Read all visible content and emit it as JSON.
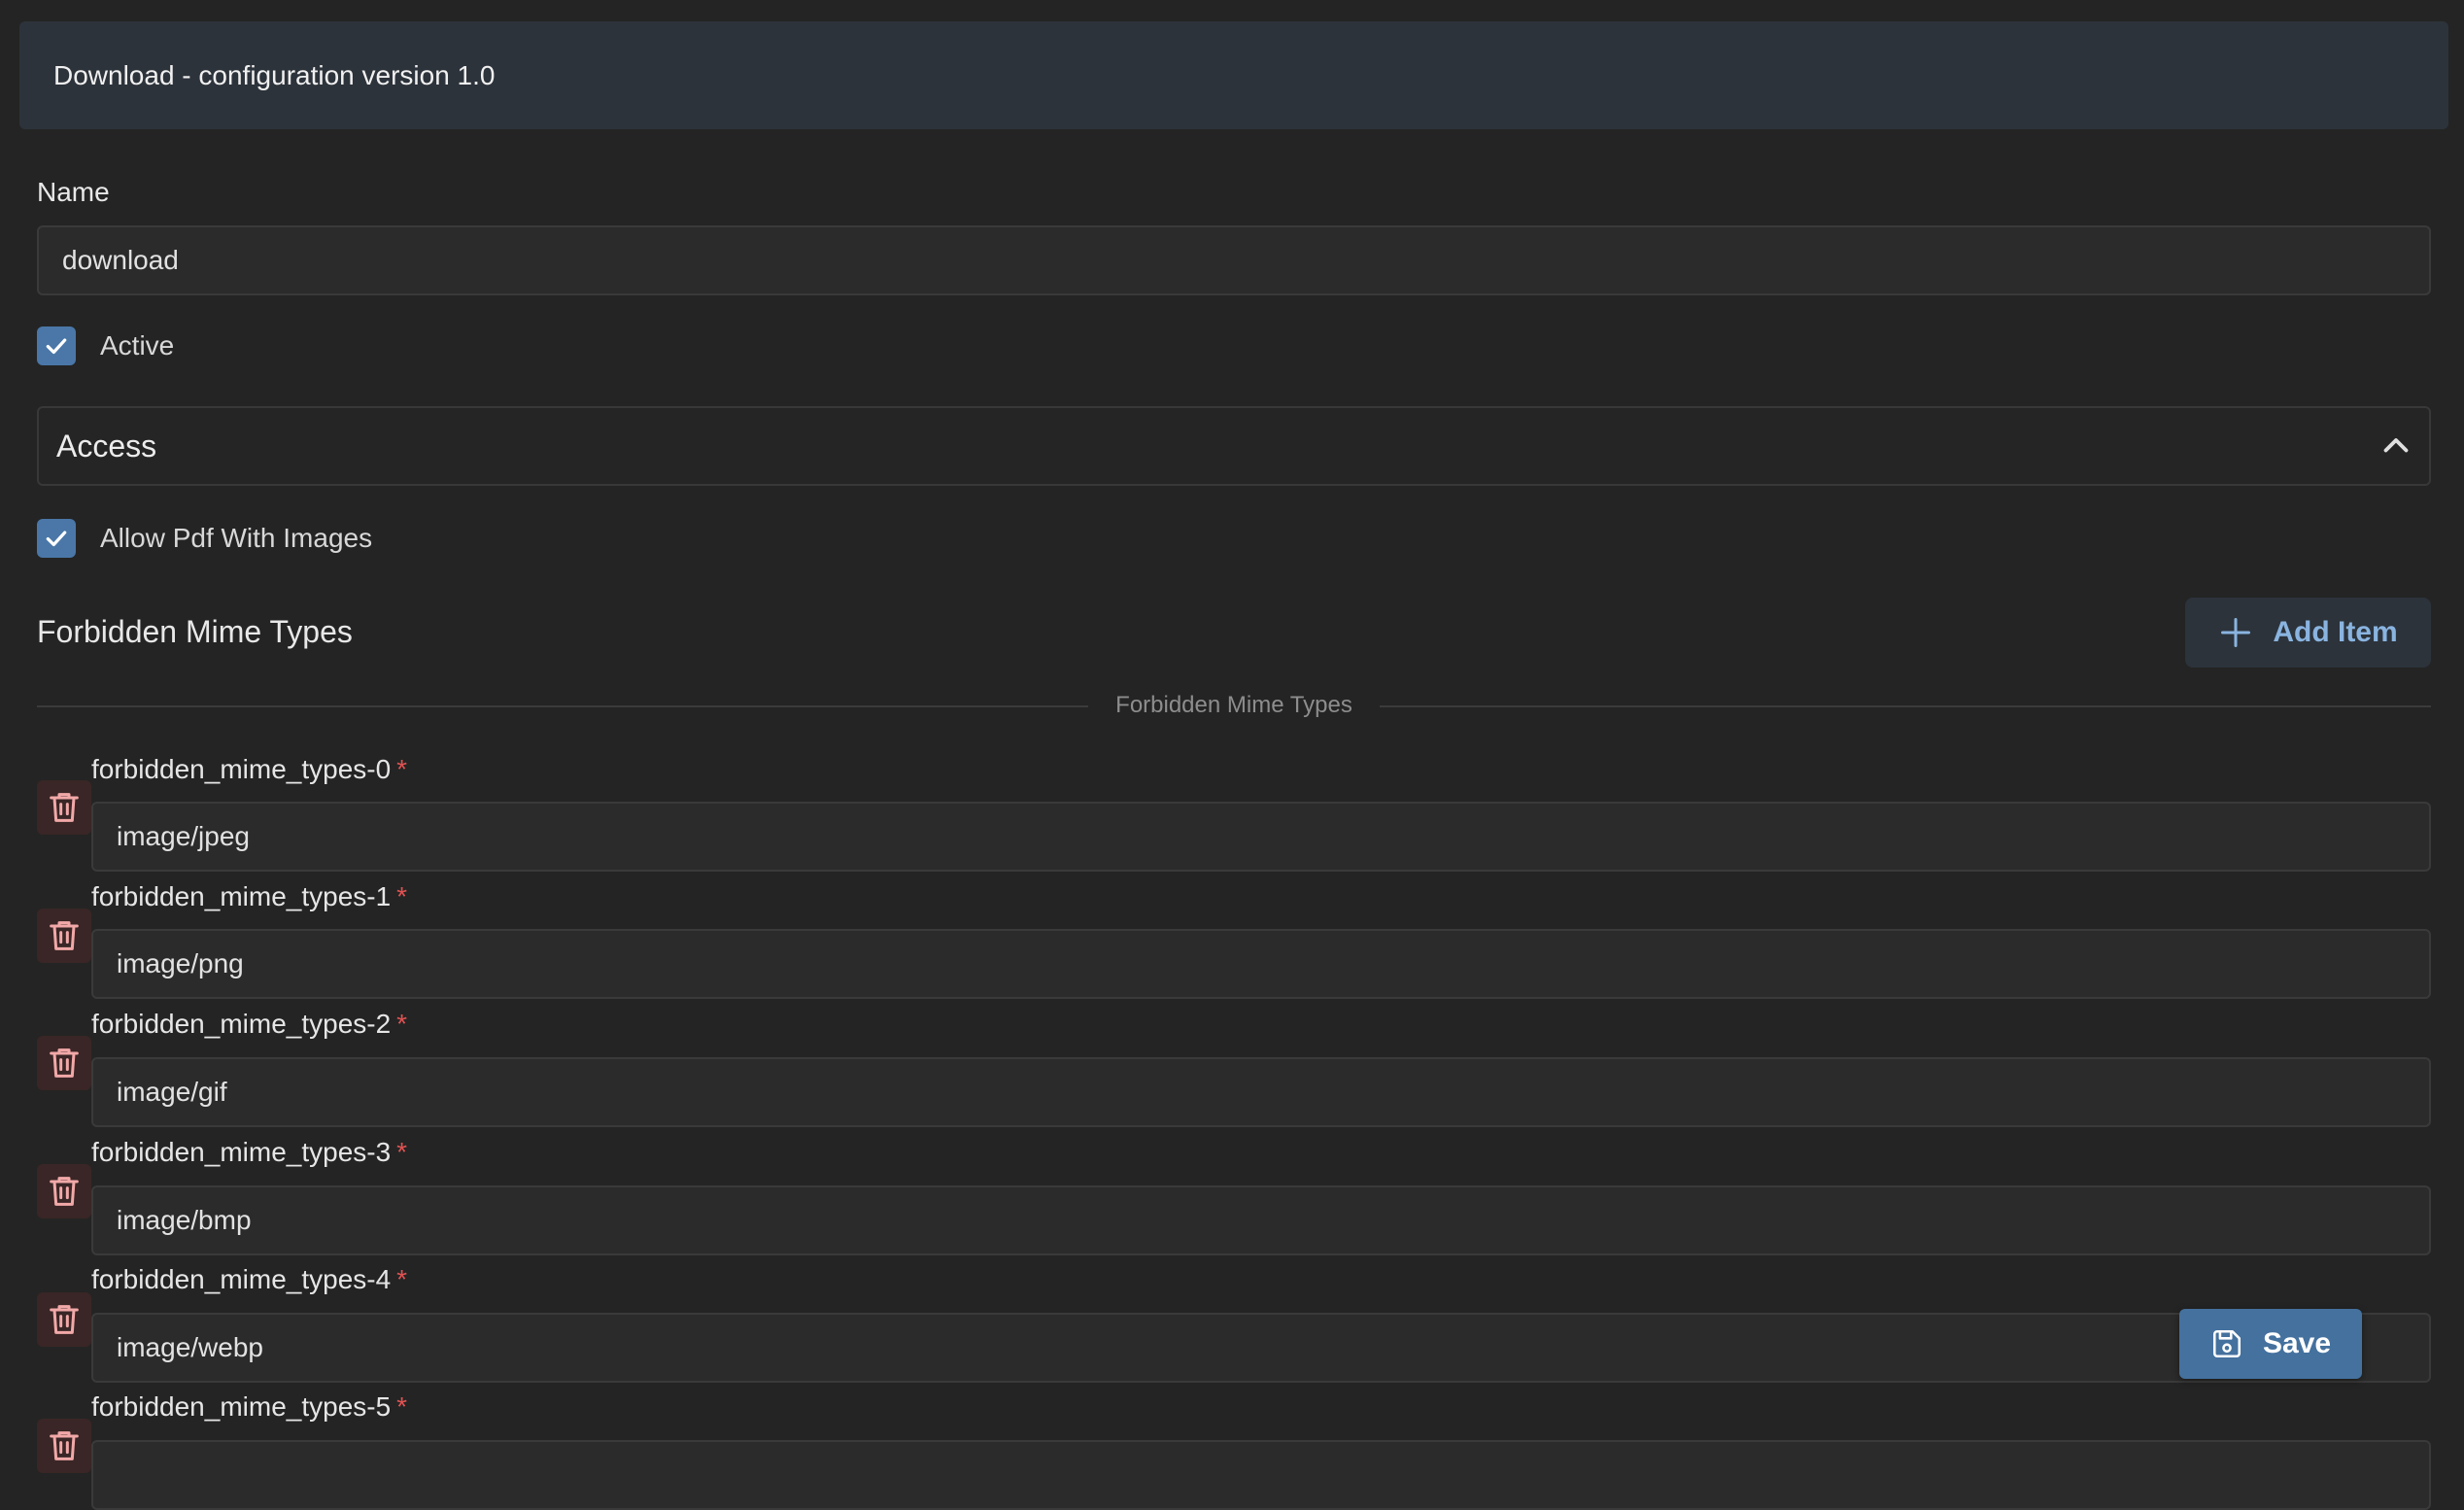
{
  "header": {
    "title": "Download - configuration version 1.0"
  },
  "name_field": {
    "label": "Name",
    "value": "download"
  },
  "active": {
    "label": "Active",
    "checked": true
  },
  "access": {
    "title": "Access",
    "expanded": true,
    "icon": "chevron-up-icon"
  },
  "allow_pdf": {
    "label": "Allow Pdf With Images",
    "checked": true
  },
  "forbidden": {
    "title": "Forbidden Mime Types",
    "add_label": "Add Item",
    "divider_label": "Forbidden Mime Types",
    "items": [
      {
        "label": "forbidden_mime_types-0",
        "value": "image/jpeg"
      },
      {
        "label": "forbidden_mime_types-1",
        "value": "image/png"
      },
      {
        "label": "forbidden_mime_types-2",
        "value": "image/gif"
      },
      {
        "label": "forbidden_mime_types-3",
        "value": "image/bmp"
      },
      {
        "label": "forbidden_mime_types-4",
        "value": "image/webp"
      },
      {
        "label": "forbidden_mime_types-5",
        "value": ""
      }
    ],
    "required_mark": "*"
  },
  "save": {
    "label": "Save",
    "icon": "floppy-disk-icon"
  },
  "colors": {
    "accent": "#4a77a8",
    "required": "#e05252",
    "delete": "#f2a8a8",
    "link": "#8ab4e0"
  }
}
